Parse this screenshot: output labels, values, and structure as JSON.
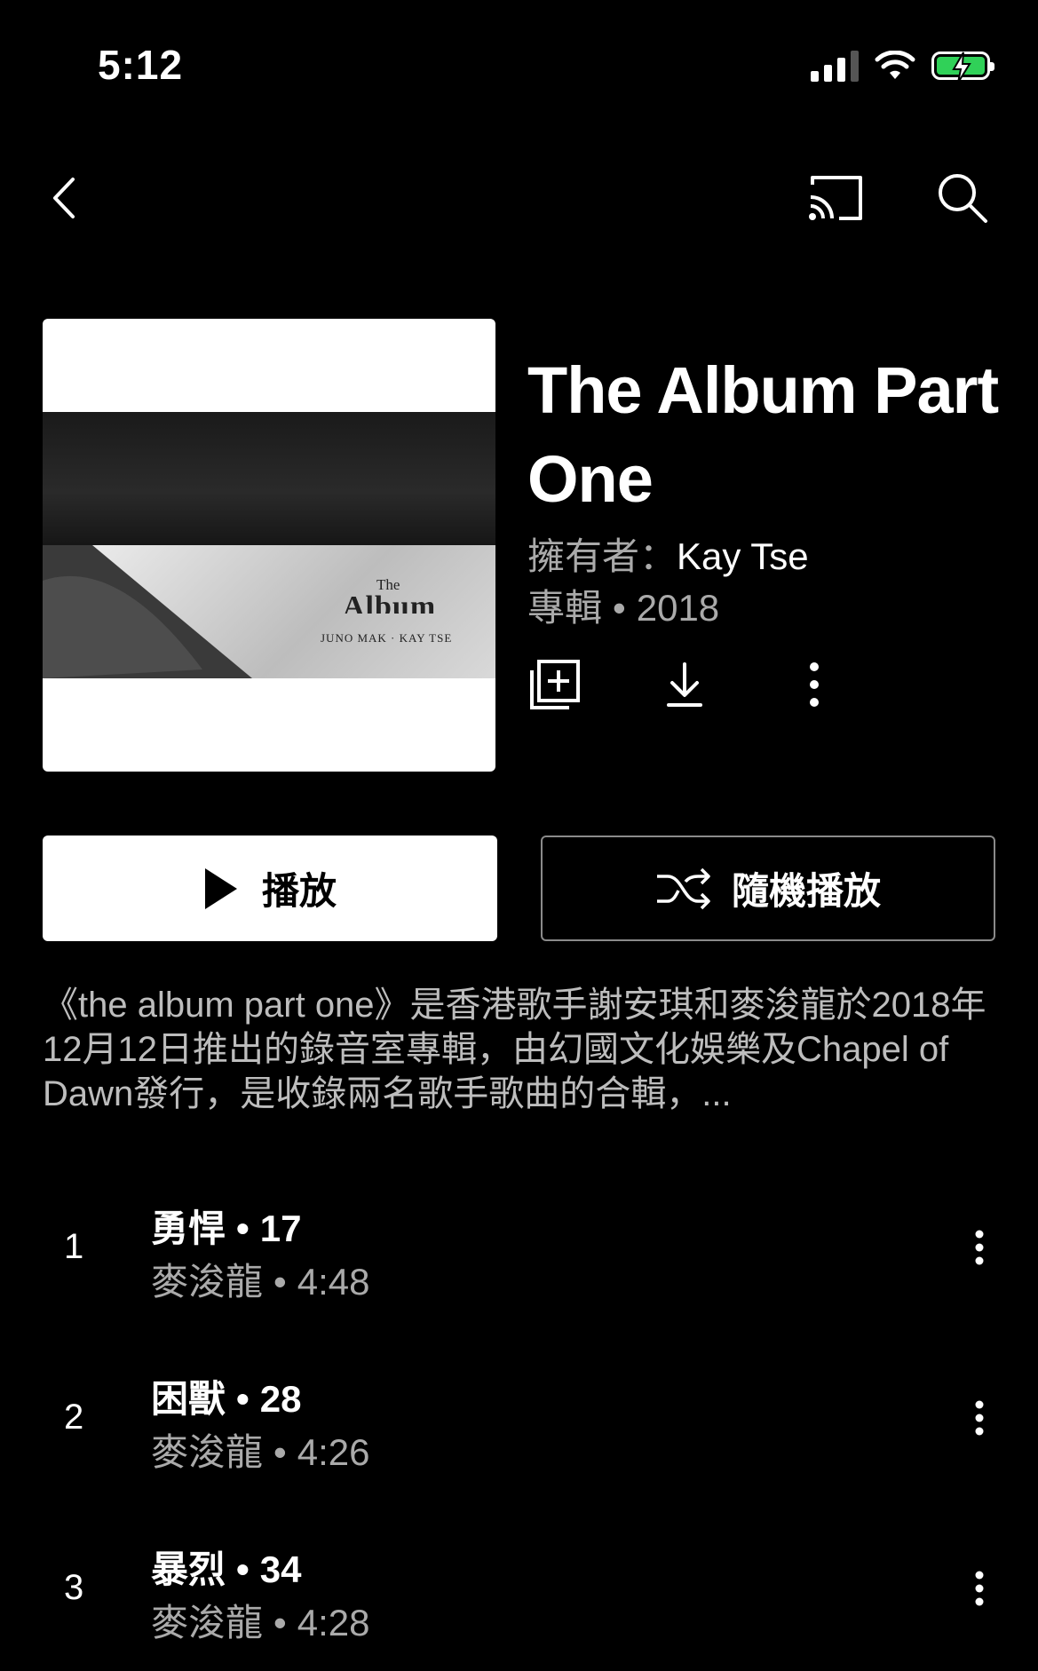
{
  "status_bar": {
    "time": "5:12"
  },
  "album": {
    "title": "The Album Part One",
    "owner_label": "擁有者：",
    "artist": "Kay Tse",
    "type": "專輯",
    "year": "2018",
    "art_text": {
      "the": "The",
      "album": "Album",
      "names": "JUNO MAK · KAY TSE"
    }
  },
  "buttons": {
    "play": "播放",
    "shuffle": "隨機播放"
  },
  "description": "《the album part one》是香港歌手謝安琪和麥浚龍於2018年12月12日推出的錄音室專輯，由幻國文化娛樂及Chapel of Dawn發行，是收錄兩名歌手歌曲的合輯，...",
  "tracks": [
    {
      "number": "1",
      "title": "勇悍",
      "index": "17",
      "artist": "麥浚龍",
      "duration": "4:48"
    },
    {
      "number": "2",
      "title": "困獸",
      "index": "28",
      "artist": "麥浚龍",
      "duration": "4:26"
    },
    {
      "number": "3",
      "title": "暴烈",
      "index": "34",
      "artist": "麥浚龍",
      "duration": "4:28"
    }
  ],
  "icons": {
    "back": "chevron-left-icon",
    "cast": "cast-icon",
    "search": "search-icon",
    "save": "add-to-library-icon",
    "download": "download-icon",
    "more": "more-vert-icon",
    "play": "play-icon",
    "shuffle": "shuffle-icon"
  },
  "colors": {
    "background": "#000000",
    "battery": "#30d158",
    "secondary_text": "#aaaaaa"
  }
}
